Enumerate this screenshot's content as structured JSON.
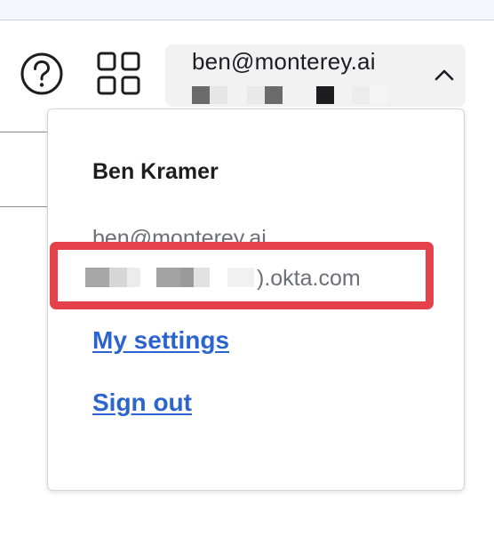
{
  "header": {
    "help_icon": "question-circle-icon",
    "apps_icon": "grid-icon",
    "account": {
      "email": "ben@monterey.ai",
      "org_redacted": true,
      "chevron_icon": "chevron-up-icon"
    }
  },
  "dropdown": {
    "name": "Ben Kramer",
    "email": "ben@monterey.ai",
    "org_domain_suffix": ").okta.com",
    "links": {
      "settings": "My settings",
      "sign_out": "Sign out"
    }
  },
  "colors": {
    "link": "#2b63cf",
    "highlight": "#e5414a",
    "account_bg": "#f2f2f2",
    "muted_text": "#6e6e78"
  }
}
